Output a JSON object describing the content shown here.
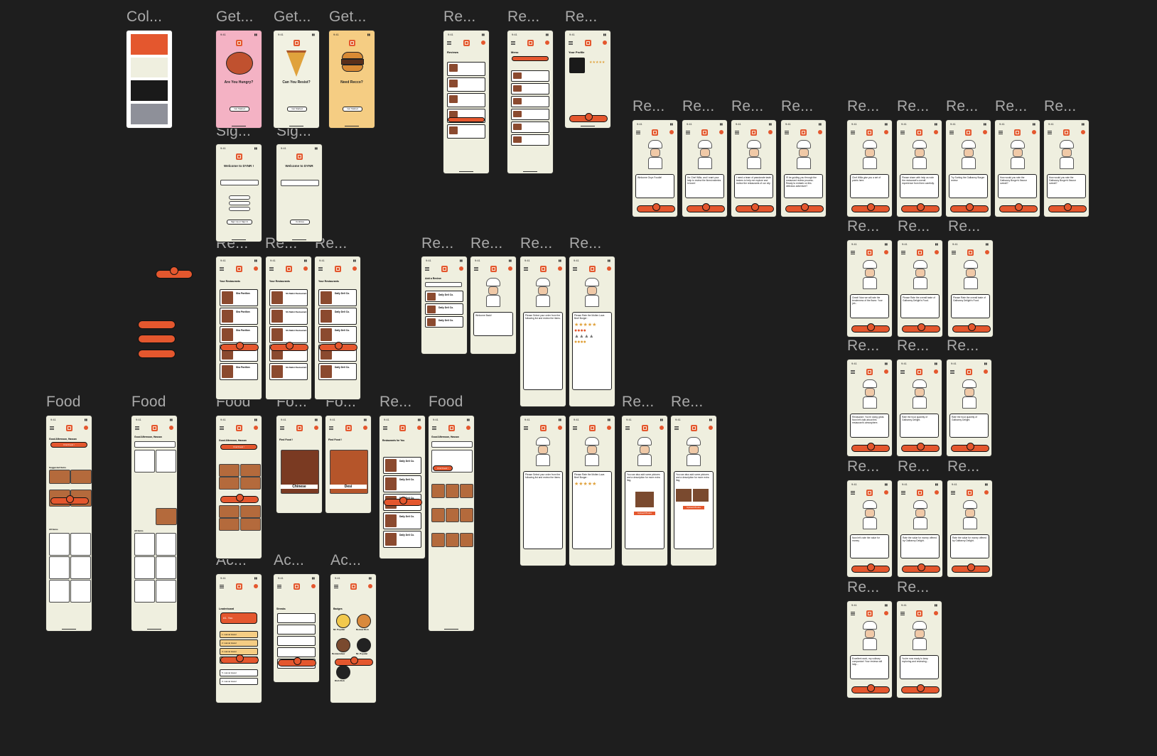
{
  "labels": {
    "colors": "Col...",
    "get": "Get...",
    "sig": "Sig...",
    "re": "Re...",
    "food": "Food",
    "fo": "Fo...",
    "ac": "Ac..."
  },
  "palette": [
    "#e4572e",
    "#efefdf",
    "#1a1a1a",
    "#8e9099"
  ],
  "onboarding": [
    {
      "title": "Are You Hungry?",
      "bg": "#f4b2c4"
    },
    {
      "title": "Can You Resist?",
      "bg": "#f1f1e2"
    },
    {
      "title": "Need Recco?",
      "bg": "#f5cd83"
    }
  ],
  "get_started": "Get Started",
  "signin": {
    "title1": "Welcome to DYNR !",
    "title2": "Welcome to DYNR",
    "button1": "Sign Up or Sign In",
    "button2": "Continue"
  },
  "restaurants": {
    "heading": "Your Restaurants",
    "names": [
      "Sha Pavilion",
      "Sh Nalini Restaurant",
      "Daily Deli Co."
    ],
    "stars": "★★★★★"
  },
  "review_screens": {
    "reviews": "Reviews",
    "menu": "Menu",
    "profile": "Your Profile",
    "add_review": "Add a Review",
    "welcome": "Welcome Back!",
    "welcome_dynr": "Welcome Onyx Foodie!",
    "rate_prompt": "Please Select your order from the following list and review the items.",
    "rate_item": "Please Rate the Molten Lava Beef Burger :",
    "photo_prompt": "You can also add some pictures and a description for more extra flag.",
    "upload_photos": "Upload Photos",
    "order_item": "Molten Lava Beef Burger"
  },
  "chef_messages": [
    "Welcome Onyx Foodie!",
    "I'm Chef Willa, and I want your help to review the finest eateries in town!",
    "I need a team of passionate taste testers to help me explore and review the restaurants of our city.",
    "I'll be guiding you through the restaurant review process. Ready to embark on this delicious adventure?",
    "Chef Willa give you a set of points here.",
    "Please share with help us note the restaurant's overall experience from them carefully.",
    "Try Sorting the Galbanny Burger review",
    "How would you rate the Galbanny Burger's flavour overall?",
    "How would you rate the Galbanny Burger's flavour overall?",
    "Great! Now we will rate the tenderness of the flavor. Your job...",
    "Please Rate the overall taste of Galbanny Delight's Food.",
    "Please Rate the overall taste of Galbanny Delight's Food.",
    "Restaurant: You're doing great. Now let's talk about this restaurant's atmosphere.",
    "Rate the food quantity of Galbanny Delight.",
    "Rate the food quantity of Galbanny Delight.",
    "Now let's rate the value for money.",
    "Rate the value for money offered by Galbanny Delight.",
    "Rate the value for money offered by Galbanny Delight.",
    "Excellent work, my culinary companion! Your reviews will help...",
    "You're now ready to keep exploring and reviewing..."
  ],
  "food": {
    "greeting": "Good Afternoon, Hassan",
    "find_food": "Find Food !",
    "suggested": "Suggested Items",
    "all_items": "All Items",
    "cuisines": [
      "Chinese",
      "Desi"
    ],
    "restaurants_for_you": "Restaurants for You"
  },
  "account": {
    "leaderboard": "Leaderboard",
    "streaks": "Streaks",
    "badges": "Badges",
    "you": "#1. You",
    "rows": [
      "1. Liamel Hassl",
      "2. Liamel Hassl",
      "3. Liamel Hassl",
      "4. Liamel Hassl",
      "5. Liamel Hassl",
      "6. Liamel Hassl"
    ],
    "badge_names": [
      "Mr. Popular",
      "Review Dish",
      "Restaurateur",
      "Mr. Popular",
      "Dish Dish"
    ]
  },
  "statusbar": {
    "time": "9:41"
  }
}
